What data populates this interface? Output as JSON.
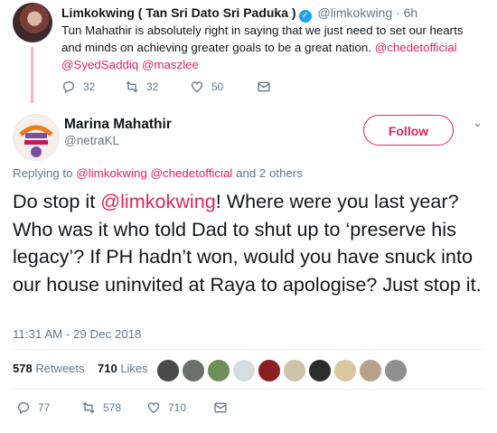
{
  "parent_tweet": {
    "name": "Limkokwing ( Tan Sri Dato Sri Paduka )",
    "handle": "@limkokwing",
    "separator": "·",
    "time": "6h",
    "text_main": "Tun Mahathir is absolutely right in saying that we just need to set our hearts and minds on achieving greater goals to be a great nation.",
    "mentions_1": "@chedetofficial",
    "mentions_2": "@SyedSaddiq",
    "mentions_3": "@maszlee",
    "replies": "32",
    "retweets": "32",
    "likes": "50"
  },
  "tweet": {
    "name": "Marina Mahathir",
    "handle": "@netraKL",
    "follow_label": "Follow",
    "replying_prefix": "Replying to",
    "replying_user_1": "@limkokwing",
    "replying_user_2": "@chedetofficial",
    "replying_suffix": "and 2 others",
    "text_1": "Do stop it ",
    "text_mention": "@limkokwing",
    "text_2": "! Where were you last year? Who was it who told Dad to shut up to ‘preserve his legacy’? If PH hadn’t won, would you have snuck into our house uninvited at Raya to apologise? Just stop it.",
    "timestamp": "11:31 AM - 29 Dec 2018",
    "retweets_count": "578",
    "retweets_label": "Retweets",
    "likes_count": "710",
    "likes_label": "Likes",
    "action_replies": "77",
    "action_retweets": "578",
    "action_likes": "710"
  },
  "colors": {
    "accent": "#e0245e",
    "muted": "#657786",
    "verified": "#1da1f2"
  },
  "icons": [
    "verified-badge-icon",
    "reply-icon",
    "retweet-icon",
    "like-icon",
    "message-icon",
    "chevron-down-icon"
  ]
}
